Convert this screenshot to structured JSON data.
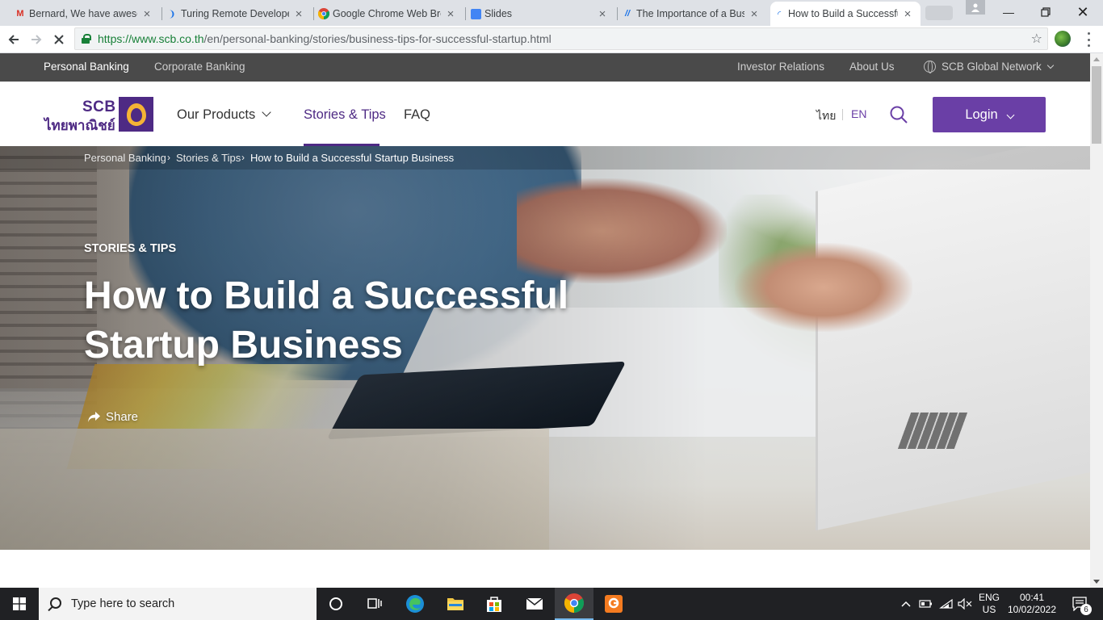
{
  "browser": {
    "tabs": [
      {
        "title": "Bernard, We have awesome",
        "favicon": "gmail-icon"
      },
      {
        "title": "Turing Remote Developer",
        "favicon": "turing-icon"
      },
      {
        "title": "Google Chrome Web Browser",
        "favicon": "chrome-icon"
      },
      {
        "title": "Slides",
        "favicon": "slides-icon"
      },
      {
        "title": "The Importance of a Business",
        "favicon": "page-icon"
      },
      {
        "title": "How to Build a Successful",
        "favicon": "loading-icon"
      }
    ],
    "url_host": "https://www.scb.co.th",
    "url_path": "/en/personal-banking/stories/business-tips-for-successful-startup.html"
  },
  "topbar": {
    "personal_banking": "Personal Banking",
    "corporate_banking": "Corporate Banking",
    "investor_relations": "Investor Relations",
    "about_us": "About Us",
    "global_network": "SCB Global Network"
  },
  "nav": {
    "logo_en": "SCB",
    "logo_th": "ไทยพาณิชย์",
    "our_products": "Our Products",
    "stories_tips": "Stories & Tips",
    "faq": "FAQ",
    "lang_th": "ไทย",
    "lang_en": "EN",
    "login": "Login"
  },
  "breadcrumb": {
    "items": [
      "Personal Banking",
      "Stories & Tips",
      "How to Build a Successful Startup Business"
    ]
  },
  "hero": {
    "kicker": "STORIES & TIPS",
    "title_line1": "How to Build a Successful",
    "title_line2": "Startup Business",
    "share": "Share"
  },
  "taskbar": {
    "search_placeholder": "Type here to search",
    "lang_line1": "ENG",
    "lang_line2": "US",
    "time": "00:41",
    "date": "10/02/2022",
    "notifications": "6"
  },
  "colors": {
    "brand_purple": "#4e2a84",
    "login_purple": "#6a3fa6",
    "topbar_gray": "#4a4a4a"
  }
}
